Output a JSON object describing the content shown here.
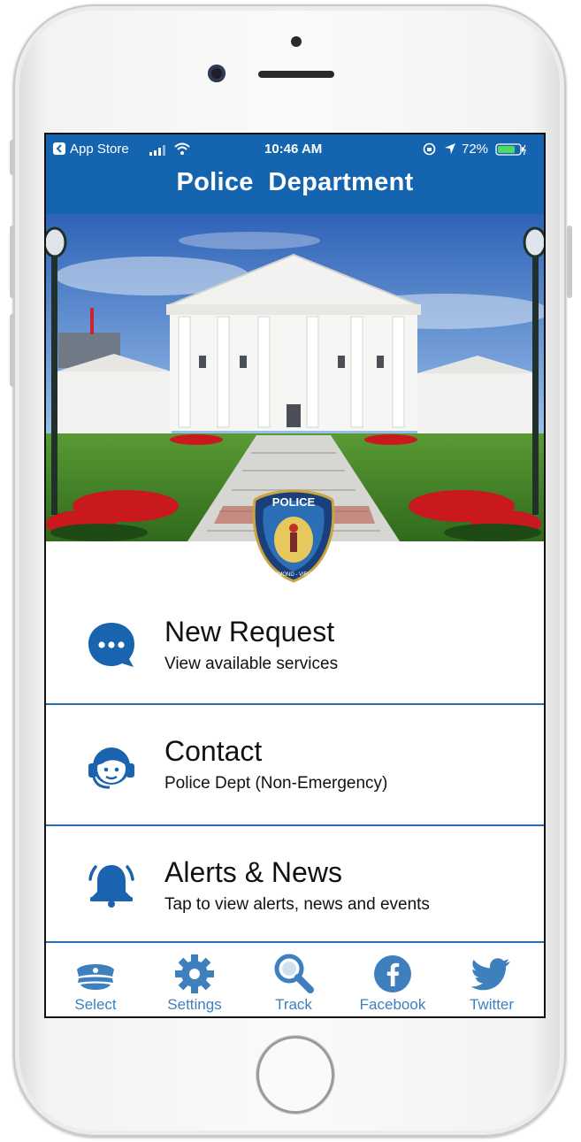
{
  "status_bar": {
    "back_app": "App Store",
    "time": "10:46 AM",
    "battery": "72%"
  },
  "header": {
    "title": "Police  Department"
  },
  "badge": {
    "top_text": "POLICE",
    "ring_text": "RICHMOND - VIRGINIA"
  },
  "menu": [
    {
      "title": "New Request",
      "subtitle": "View available services",
      "icon": "chat-bubble-icon"
    },
    {
      "title": "Contact",
      "subtitle": "Police Dept (Non-Emergency)",
      "icon": "headset-agent-icon"
    },
    {
      "title": "Alerts & News",
      "subtitle": "Tap to view alerts, news and events",
      "icon": "bell-icon"
    }
  ],
  "tabs": [
    {
      "label": "Select",
      "icon": "police-cap-icon"
    },
    {
      "label": "Settings",
      "icon": "gear-icon"
    },
    {
      "label": "Track",
      "icon": "magnifier-icon"
    },
    {
      "label": "Facebook",
      "icon": "facebook-icon"
    },
    {
      "label": "Twitter",
      "icon": "twitter-bird-icon"
    }
  ],
  "colors": {
    "brand_blue": "#1564b0",
    "icon_blue": "#1a63ae",
    "tab_blue": "#3e7fbd",
    "divider": "#2a6cb0"
  }
}
